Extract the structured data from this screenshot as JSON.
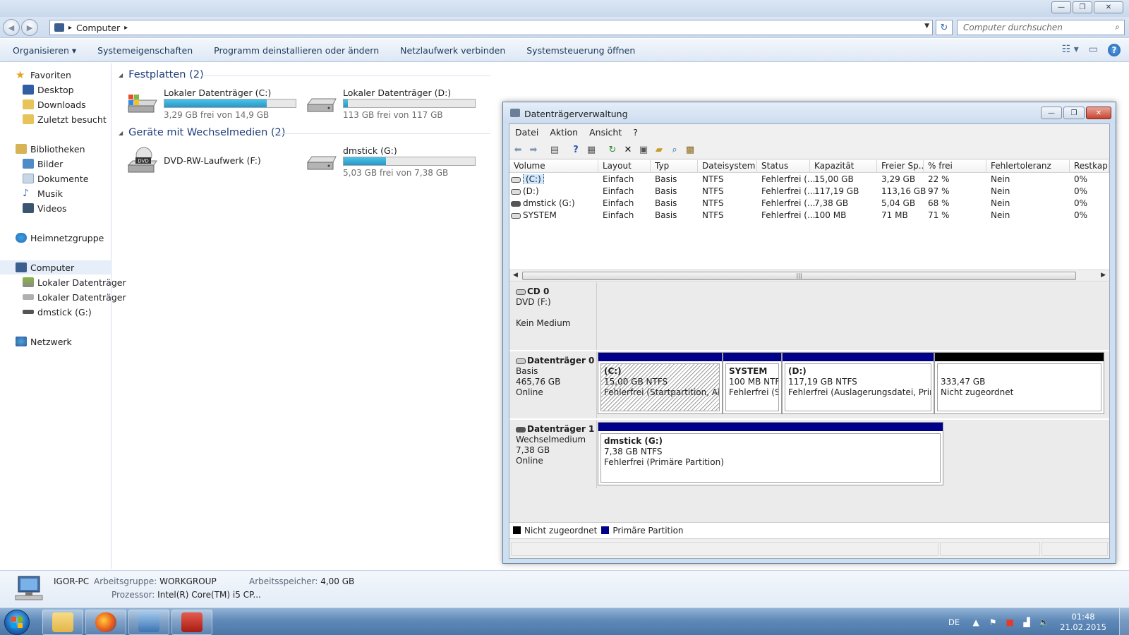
{
  "explorer": {
    "address": {
      "crumb": "Computer",
      "arrow": "▸"
    },
    "search_placeholder": "Computer durchsuchen",
    "commands": [
      "Organisieren ▾",
      "Systemeigenschaften",
      "Programm deinstallieren oder ändern",
      "Netzlaufwerk verbinden",
      "Systemsteuerung öffnen"
    ],
    "window_buttons": {
      "minimize": "—",
      "maximize": "❐",
      "close": "✕"
    }
  },
  "nav": {
    "favorites": "Favoriten",
    "desktop": "Desktop",
    "downloads": "Downloads",
    "recent": "Zuletzt besucht",
    "libraries": "Bibliotheken",
    "pictures": "Bilder",
    "documents": "Dokumente",
    "music": "Musik",
    "videos": "Videos",
    "homegroup": "Heimnetzgruppe",
    "computer": "Computer",
    "local_c": "Lokaler Datenträger",
    "local_d": "Lokaler Datenträger",
    "dmstick": "dmstick (G:)",
    "network": "Netzwerk"
  },
  "content": {
    "hdd_group": "Festplatten (2)",
    "removable_group": "Geräte mit Wechselmedien (2)",
    "drive_c": {
      "name": "Lokaler Datenträger (C:)",
      "free": "3,29 GB frei von 14,9 GB",
      "used_fraction": 0.78
    },
    "drive_d": {
      "name": "Lokaler Datenträger (D:)",
      "free": "113 GB frei von 117 GB",
      "used_fraction": 0.03
    },
    "drive_f": {
      "name": "DVD-RW-Laufwerk (F:)",
      "badge": "DVD"
    },
    "drive_g": {
      "name": "dmstick (G:)",
      "free": "5,03 GB frei von 7,38 GB",
      "used_fraction": 0.32
    }
  },
  "details": {
    "pc_name": "IGOR-PC",
    "workgroup_label": "Arbeitsgruppe:",
    "workgroup": "WORKGROUP",
    "memory_label": "Arbeitsspeicher:",
    "memory": "4,00 GB",
    "cpu_label": "Prozessor:",
    "cpu": "Intel(R) Core(TM) i5 CP..."
  },
  "taskbar": {
    "lang": "DE",
    "time": "01:48",
    "date": "21.02.2015"
  },
  "diskmgmt": {
    "title": "Datenträgerverwaltung",
    "menu": [
      "Datei",
      "Aktion",
      "Ansicht",
      "?"
    ],
    "columns": [
      "Volume",
      "Layout",
      "Typ",
      "Dateisystem",
      "Status",
      "Kapazität",
      "Freier Sp...",
      "% frei",
      "Fehlertoleranz",
      "Restkap"
    ],
    "rows": [
      {
        "volume": "(C:)",
        "layout": "Einfach",
        "typ": "Basis",
        "fs": "NTFS",
        "status": "Fehlerfrei (...",
        "cap": "15,00 GB",
        "free": "3,29 GB",
        "pct": "22 %",
        "ft": "Nein",
        "rest": "0%"
      },
      {
        "volume": "(D:)",
        "layout": "Einfach",
        "typ": "Basis",
        "fs": "NTFS",
        "status": "Fehlerfrei (...",
        "cap": "117,19 GB",
        "free": "113,16 GB",
        "pct": "97 %",
        "ft": "Nein",
        "rest": "0%"
      },
      {
        "volume": "dmstick (G:)",
        "layout": "Einfach",
        "typ": "Basis",
        "fs": "NTFS",
        "status": "Fehlerfrei (...",
        "cap": "7,38 GB",
        "free": "5,04 GB",
        "pct": "68 %",
        "ft": "Nein",
        "rest": "0%"
      },
      {
        "volume": "SYSTEM",
        "layout": "Einfach",
        "typ": "Basis",
        "fs": "NTFS",
        "status": "Fehlerfrei (...",
        "cap": "100 MB",
        "free": "71 MB",
        "pct": "71 %",
        "ft": "Nein",
        "rest": "0%"
      }
    ],
    "cd0": {
      "name": "CD 0",
      "line1": "DVD (F:)",
      "line2": "Kein Medium"
    },
    "disk0": {
      "name": "Datenträger 0",
      "type": "Basis",
      "size": "465,76 GB",
      "state": "Online",
      "p_c": {
        "name": "(C:)",
        "size": "15,00 GB NTFS",
        "status": "Fehlerfrei (Startpartition, Absturz"
      },
      "p_sys": {
        "name": "SYSTEM",
        "size": "100 MB NTFS",
        "status": "Fehlerfrei (Sys"
      },
      "p_d": {
        "name": "(D:)",
        "size": "117,19 GB NTFS",
        "status": "Fehlerfrei (Auslagerungsdatei, Primäre"
      },
      "p_un": {
        "size": "333,47 GB",
        "status": "Nicht zugeordnet"
      }
    },
    "disk1": {
      "name": "Datenträger 1",
      "type": "Wechselmedium",
      "size": "7,38 GB",
      "state": "Online",
      "p_g": {
        "name": "dmstick  (G:)",
        "size": "7,38 GB NTFS",
        "status": "Fehlerfrei (Primäre Partition)"
      }
    },
    "legend": {
      "unallocated": "Nicht zugeordnet",
      "primary": "Primäre Partition"
    },
    "colors": {
      "primary": "#00008b",
      "unallocated": "#000000"
    }
  }
}
